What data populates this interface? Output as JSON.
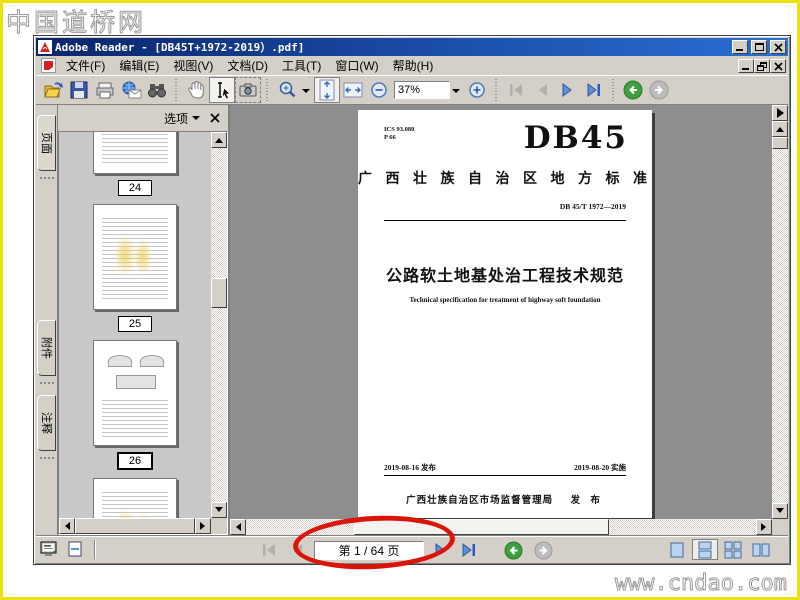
{
  "watermark": {
    "site_cn": "中国道桥网",
    "site_url": "www.cndao.com"
  },
  "titlebar": {
    "title": "Adobe Reader - [DB45T+1972-2019）.pdf]"
  },
  "menubar": {
    "items": [
      "文件(F)",
      "编辑(E)",
      "视图(V)",
      "文档(D)",
      "工具(T)",
      "窗口(W)",
      "帮助(H)"
    ]
  },
  "toolbar": {
    "zoom_value": "37%"
  },
  "sidebar": {
    "tabs": [
      {
        "label": "页面"
      },
      {
        "label": "附件"
      },
      {
        "label": "注释"
      }
    ],
    "header": {
      "options": "选项"
    },
    "thumbnails": [
      {
        "label": "24"
      },
      {
        "label": "25"
      },
      {
        "label": "26"
      }
    ]
  },
  "page": {
    "ics": "ICS 93.080",
    "class_no": "P 66",
    "code": "DB45",
    "standard_title": "广 西 壮 族 自 治 区 地 方 标 准",
    "standard_no": "DB 45/T 1972—2019",
    "title_cn": "公路软土地基处治工程技术规范",
    "title_en": "Technical specification for treatment of highway soft foundation",
    "issue_date": "2019-08-16 发布",
    "impl_date": "2019-08-20 实施",
    "issuer": "广西壮族自治区市场监督管理局",
    "publish": "发 布"
  },
  "statusbar": {
    "page_indicator": "第 1 / 64 页"
  },
  "colors": {
    "chrome": "#d4d0c8",
    "title_gradient_start": "#0a246a",
    "title_gradient_end": "#2a6fd4",
    "accent_blue": "#5b8fd8",
    "annotation_red": "#da1408",
    "highlight_yellow": "#e4c428",
    "border_yellow": "#ede10a",
    "doc_background": "#8e8e8e"
  }
}
